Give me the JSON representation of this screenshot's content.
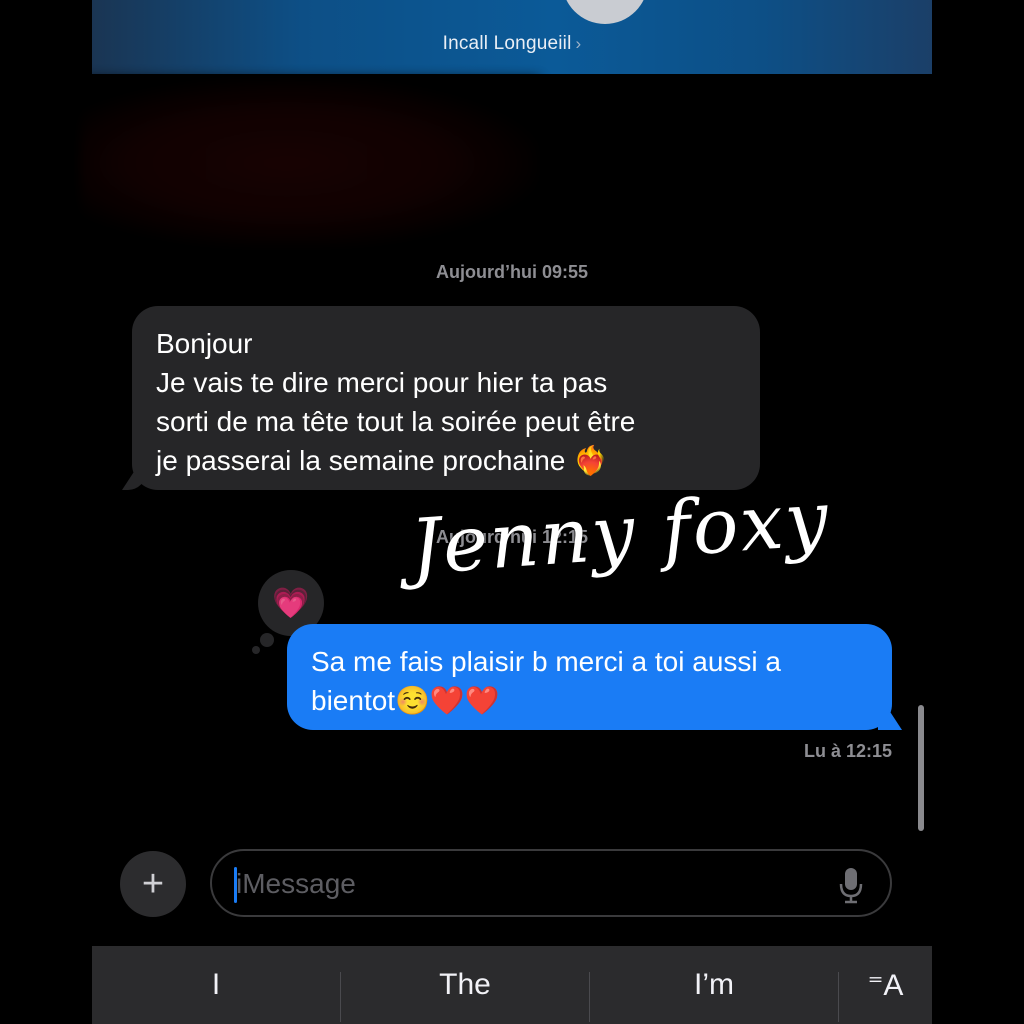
{
  "header": {
    "contact_name": "Incall Longueiil",
    "chevron": "›"
  },
  "messages": [
    {
      "timestamp": "Aujourd’hui 09:55",
      "direction": "incoming",
      "lines": [
        "Bonjour",
        "Je vais te dire merci pour hier ta pas",
        "sorti de ma tête tout la soirée peut être",
        "je passerai la semaine prochaine ❤️‍🔥"
      ]
    },
    {
      "timestamp": "Aujourd’hui 12:15",
      "direction": "outgoing",
      "lines": [
        "Sa me fais plaisir b merci a toi aussi a",
        "bientot☺️❤️❤️"
      ],
      "reaction": "💗",
      "read_receipt": "Lu à 12:15"
    }
  ],
  "watermark": "Jenny foxy",
  "composer": {
    "plus_label": "+",
    "placeholder": "iMessage",
    "mic_icon": "microphone-icon"
  },
  "keyboard_suggestions": [
    "I",
    "The",
    "I’m"
  ],
  "keyboard_format_label": "⁼A",
  "colors": {
    "outgoing_bubble": "#1a7cf5",
    "incoming_bubble": "#262628",
    "header_gradient": "#0b5a98"
  }
}
